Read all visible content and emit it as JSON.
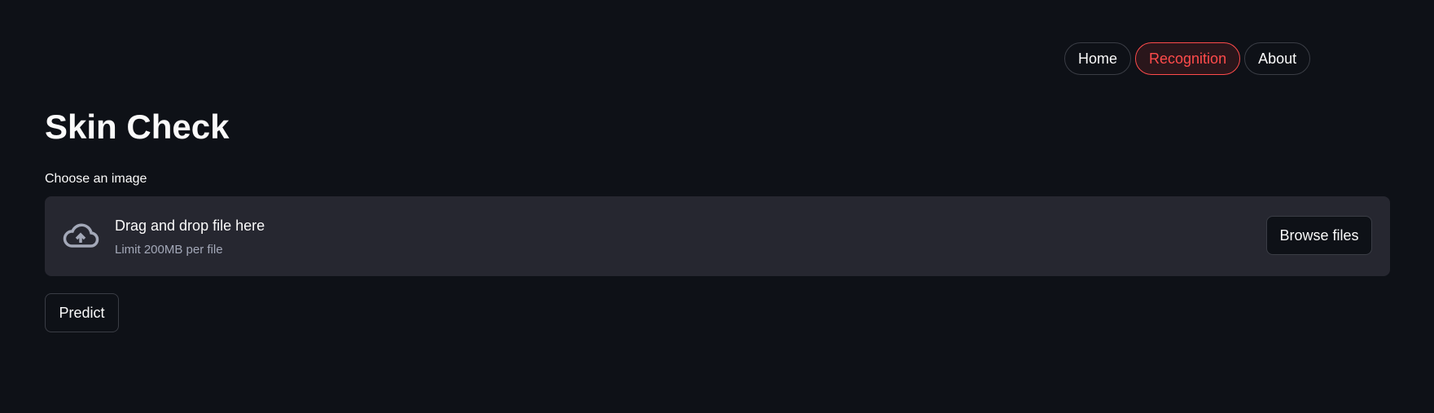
{
  "nav": {
    "items": [
      {
        "label": "Home",
        "active": false
      },
      {
        "label": "Recognition",
        "active": true
      },
      {
        "label": "About",
        "active": false
      }
    ],
    "accent": "#ff4b4b"
  },
  "page": {
    "title": "Skin Check"
  },
  "uploader": {
    "label": "Choose an image",
    "drop_text": "Drag and drop file here",
    "limit_text": "Limit 200MB per file",
    "browse_label": "Browse files",
    "icon": "cloud-upload-icon"
  },
  "actions": {
    "predict_label": "Predict"
  }
}
